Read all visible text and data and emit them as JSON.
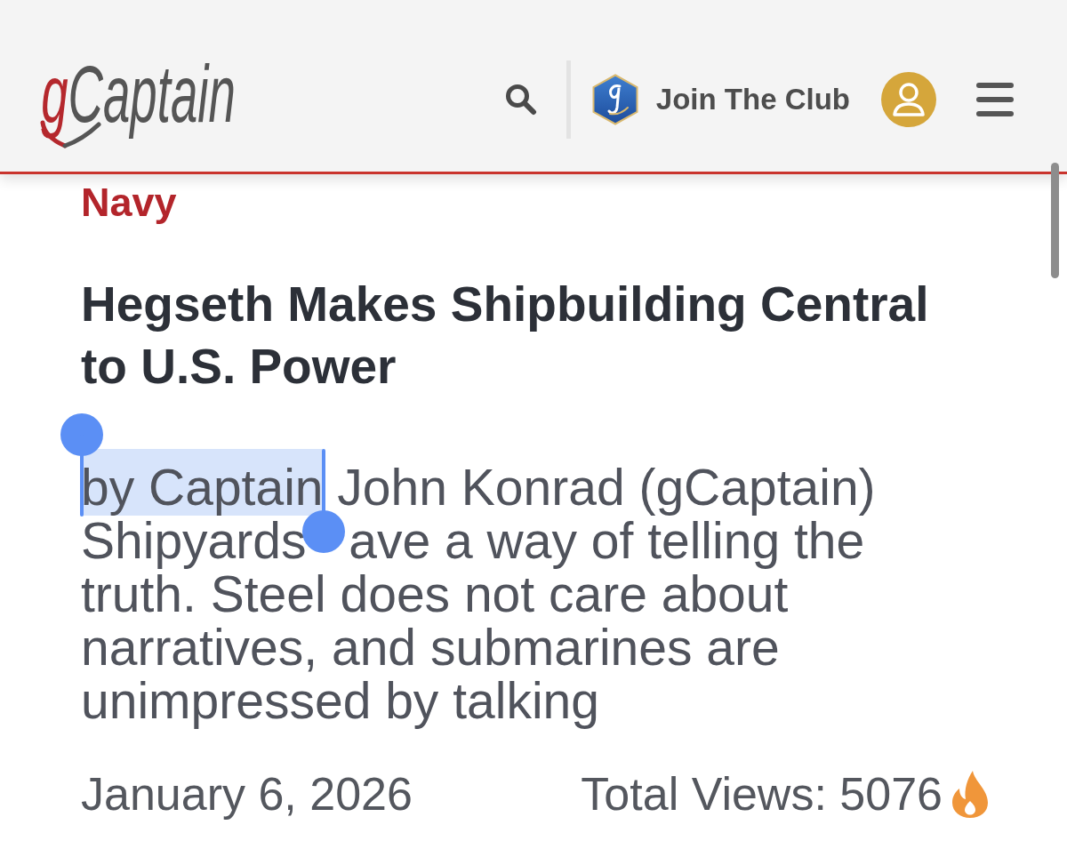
{
  "header": {
    "logo": {
      "parts": [
        {
          "text": "g",
          "color": "#b5282d"
        },
        {
          "text": "Captain",
          "color": "#555555"
        }
      ]
    },
    "join_link": "Join The Club"
  },
  "article": {
    "category": "Navy",
    "headline": "Hegseth Makes Shipbuilding Central to U.S. Power",
    "byline": [
      {
        "text": "by Captain",
        "selected": true
      },
      {
        "text": "John Konrad (gCaptain)",
        "selected": false
      }
    ],
    "excerpt": {
      "parts": [
        "Shipyards",
        "ave a way of telling the truth. Steel does not care about narratives, and submarines are unimpressed by talking"
      ]
    },
    "date": "January 6, 2026",
    "views": "Total Views: 5076"
  }
}
